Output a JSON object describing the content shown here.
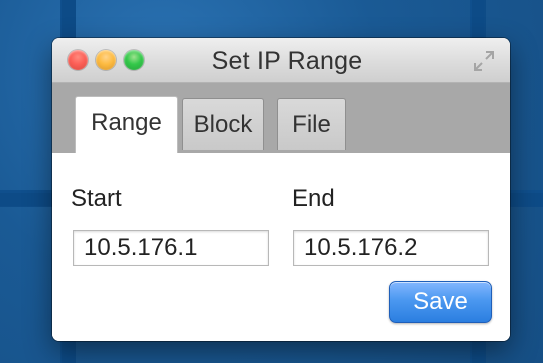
{
  "window": {
    "title": "Set IP Range"
  },
  "tabs": [
    {
      "label": "Range",
      "active": true
    },
    {
      "label": "Block",
      "active": false
    },
    {
      "label": "File",
      "active": false
    }
  ],
  "form": {
    "start_label": "Start",
    "end_label": "End",
    "start_value": "10.5.176.1",
    "end_value": "10.5.176.2"
  },
  "buttons": {
    "save_label": "Save"
  },
  "colors": {
    "desktop_blue": "#1c5d97",
    "tab_strip_gray": "#a8a8a8",
    "save_blue": "#3f8ff0",
    "close_red": "#fc5f57",
    "minimize_yellow": "#fdbb41",
    "zoom_green": "#34c84a"
  },
  "icons": {
    "close": "close-icon",
    "minimize": "minimize-icon",
    "zoom": "zoom-icon",
    "fullscreen": "fullscreen-icon"
  }
}
